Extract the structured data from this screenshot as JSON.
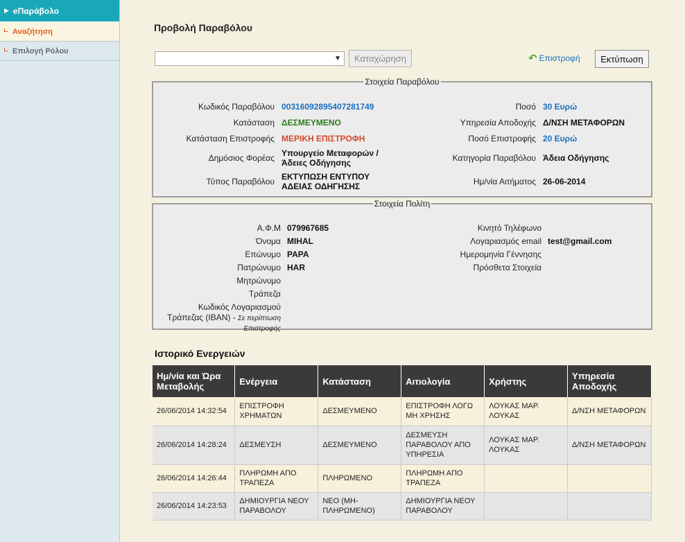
{
  "sidebar": {
    "header": "eΠαράβολο",
    "items": [
      {
        "label": "Αναζήτηση"
      },
      {
        "label": "Επιλογή Ρόλου"
      }
    ]
  },
  "page": {
    "title": "Προβολή Παραβόλου",
    "select_value": "",
    "register_label": "Καταχώρηση",
    "back_label": "Επιστροφή",
    "print_label": "Εκτύπωση"
  },
  "fee": {
    "legend": "Στοιχεία Παραβόλου",
    "code_label": "Κωδικός Παραβόλου",
    "code": "00316092895407281749",
    "status_label": "Κατάσταση",
    "status": "ΔΕΣΜΕΥΜΕΝΟ",
    "refund_status_label": "Κατάσταση Επιστροφής",
    "refund_status": "ΜΕΡΙΚΗ ΕΠΙΣΤΡΟΦΗ",
    "body_label": "Δημόσιος Φορέας",
    "body_line1": "Υπουργείο Μεταφορών /",
    "body_line2": "Άδειες Οδήγησης",
    "type_label": "Τύπος Παραβόλου",
    "type_line1": "ΕΚΤΥΠΩΣΗ ΕΝΤΥΠΟΥ",
    "type_line2": "ΑΔΕΙΑΣ ΟΔΗΓΗΣΗΣ",
    "amount_label": "Ποσό",
    "amount": "30 Ευρώ",
    "service_label": "Υπηρεσία Αποδοχής",
    "service": "Δ/ΝΣΗ ΜΕΤΑΦΟΡΩΝ",
    "refund_amount_label": "Ποσό Επιστροφής",
    "refund_amount": "20 Ευρώ",
    "category_label": "Κατηγορία Παραβόλου",
    "category": "Άδεια Οδήγησης",
    "request_date_label": "Ημ/νία Αιτήματος",
    "request_date": "26-06-2014"
  },
  "citizen": {
    "legend": "Στοιχεία Πολίτη",
    "afm_label": "Α.Φ.Μ",
    "afm": "079967685",
    "name_label": "Όνομα",
    "name": "MIHAL",
    "surname_label": "Επώνυμο",
    "surname": "PAPA",
    "father_label": "Πατρώνυμο",
    "father": "HAR",
    "mother_label": "Μητρώνυμο",
    "bank_label": "Τράπεζα",
    "iban_label_1": "Κωδικός Λογαριασμού",
    "iban_label_2": "Τράπεζας (IBAN) -",
    "iban_note_1": "Σε περίπτωση",
    "iban_note_2": "Επιστροφής",
    "mobile_label": "Κινητό Τηλέφωνο",
    "email_label": "Λογαριασμός email",
    "email": "test@gmail.com",
    "birth_label": "Ημερομηνία Γέννησης",
    "extra_label": "Πρόσθετα Στοιχεία"
  },
  "history": {
    "title": "Ιστορικό Ενεργειών",
    "headers": [
      "Ημ/νία και Ώρα Μεταβολής",
      "Ενέργεια",
      "Κατάσταση",
      "Αιτιολογία",
      "Χρήστης",
      "Υπηρεσία Αποδοχής"
    ],
    "rows": [
      {
        "date": "26/06/2014 14:32:54",
        "action": "ΕΠΙΣΤΡΟΦΗ ΧΡΗΜΑΤΩΝ",
        "status": "ΔΕΣΜΕΥΜΕΝΟ",
        "reason": "ΕΠΙΣΤΡΟΦΗ ΛΟΓΩ ΜΗ ΧΡΗΣΗΣ",
        "user": "ΛΟΥΚΑΣ ΜΑΡ. ΛΟΥΚΑΣ",
        "service": "Δ/ΝΣΗ ΜΕΤΑΦΟΡΩΝ"
      },
      {
        "date": "26/06/2014 14:28:24",
        "action": "ΔΕΣΜΕΥΣΗ",
        "status": "ΔΕΣΜΕΥΜΕΝΟ",
        "reason": "ΔΕΣΜΕΥΣΗ ΠΑΡΑΒΟΛΟΥ ΑΠΟ ΥΠΗΡΕΣΙΑ",
        "user": "ΛΟΥΚΑΣ ΜΑΡ. ΛΟΥΚΑΣ",
        "service": "Δ/ΝΣΗ ΜΕΤΑΦΟΡΩΝ"
      },
      {
        "date": "26/06/2014 14:26:44",
        "action": "ΠΛΗΡΩΜΗ ΑΠΟ ΤΡΑΠΕΖΑ",
        "status": "ΠΛΗΡΩΜΕΝΟ",
        "reason": "ΠΛΗΡΩΜΗ ΑΠΟ ΤΡΑΠΕΖΑ",
        "user": "",
        "service": ""
      },
      {
        "date": "26/06/2014 14:23:53",
        "action": "ΔΗΜΙΟΥΡΓΙΑ ΝΕΟΥ ΠΑΡΑΒΟΛΟΥ",
        "status": "ΝΕΟ (ΜΗ-ΠΛΗΡΩΜΕΝΟ)",
        "reason": "ΔΗΜΙΟΥΡΓΙΑ ΝΕΟΥ ΠΑΡΑΒΟΛΟΥ",
        "user": "",
        "service": ""
      }
    ]
  },
  "colors": {
    "accent": "#1aa7b8",
    "link": "#1c6fc0",
    "status_green": "#2b7d1e",
    "status_red": "#d0492c"
  }
}
